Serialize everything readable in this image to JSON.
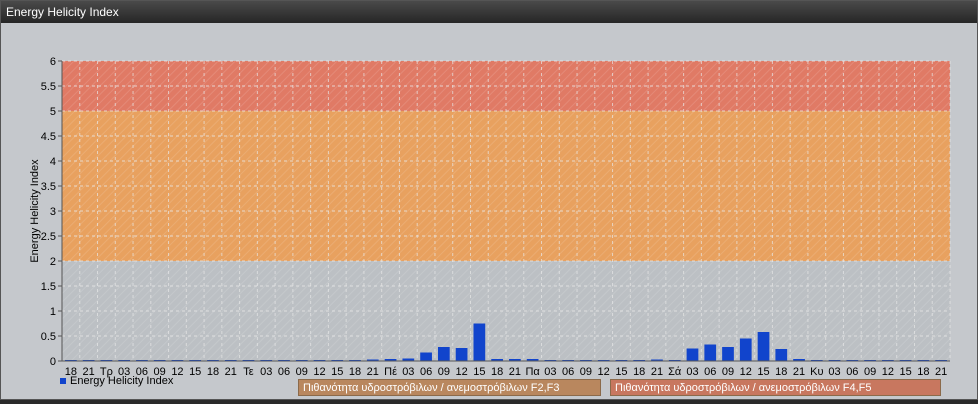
{
  "window": {
    "title": "Energy Helicity Index"
  },
  "legend": {
    "series_label": "Energy Helicity Index"
  },
  "bands": [
    {
      "label": "Πιθανότητα υδροστρόβιλων / ανεμοστρόβιλων F2,F3",
      "color": "#e8a15f",
      "from": 2,
      "to": 5
    },
    {
      "label": "Πιθανότητα υδροστρόβιλων / ανεμοστρόβιλων F4,F5",
      "color": "#e07a65",
      "from": 5,
      "to": 6
    },
    {
      "label": "",
      "color": "#bcc0c4",
      "from": 0,
      "to": 2
    }
  ],
  "colors": {
    "bar": "#1144cc",
    "grid": "#e8e8e8"
  },
  "chart_data": {
    "type": "bar",
    "ylabel": "Energy Helicity Index",
    "ylim": [
      0,
      6
    ],
    "yticks": [
      "0",
      "0.5",
      "1",
      "1.5",
      "2",
      "2.5",
      "3",
      "3.5",
      "4",
      "4.5",
      "5",
      "5.5",
      "6"
    ],
    "grid": true,
    "legend_position": "bottom-left",
    "categories": [
      "18",
      "21",
      "Τρ",
      "03",
      "06",
      "09",
      "12",
      "15",
      "18",
      "21",
      "Τε",
      "03",
      "06",
      "09",
      "12",
      "15",
      "18",
      "21",
      "Πέ",
      "03",
      "06",
      "09",
      "12",
      "15",
      "18",
      "21",
      "Πα",
      "03",
      "06",
      "09",
      "12",
      "15",
      "18",
      "21",
      "Σά",
      "03",
      "06",
      "09",
      "12",
      "15",
      "18",
      "21",
      "Κυ",
      "03",
      "06",
      "09",
      "12",
      "15",
      "18",
      "21"
    ],
    "series": [
      {
        "name": "Energy Helicity Index",
        "values": [
          0.01,
          0.01,
          0.01,
          0.01,
          0.01,
          0.01,
          0.01,
          0.01,
          0.01,
          0.01,
          0.01,
          0.01,
          0.01,
          0.01,
          0.01,
          0.01,
          0.02,
          0.03,
          0.04,
          0.05,
          0.17,
          0.28,
          0.26,
          0.75,
          0.04,
          0.04,
          0.04,
          0.01,
          0.01,
          0.01,
          0.01,
          0.01,
          0.01,
          0.03,
          0.01,
          0.25,
          0.33,
          0.28,
          0.45,
          0.58,
          0.24,
          0.04,
          0.01,
          0.01,
          0.01,
          0.01,
          0.01,
          0.01,
          0.01,
          0.01
        ]
      }
    ]
  }
}
